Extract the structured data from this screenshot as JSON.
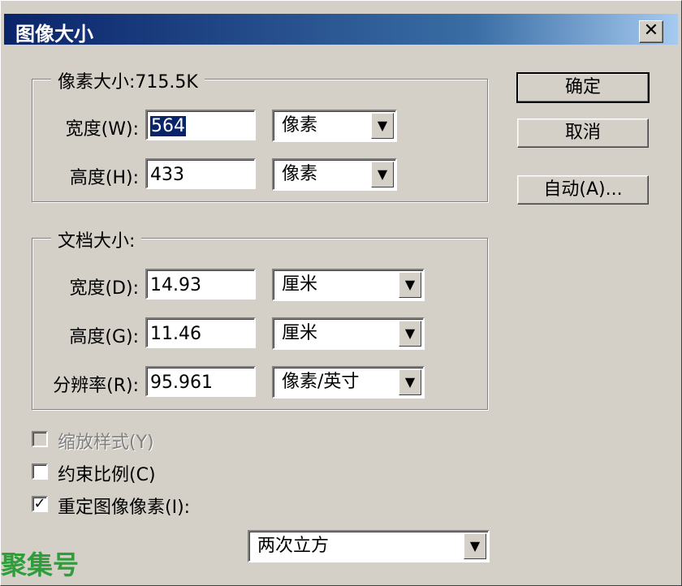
{
  "window": {
    "title": "图像大小",
    "close_glyph": "✕"
  },
  "pixel_dimensions": {
    "legend": "像素大小:715.5K",
    "width": {
      "label": "宽度(W):",
      "value": "564",
      "unit": "像素"
    },
    "height": {
      "label": "高度(H):",
      "value": "433",
      "unit": "像素"
    }
  },
  "document_size": {
    "legend": "文档大小:",
    "width": {
      "label": "宽度(D):",
      "value": "14.93",
      "unit": "厘米"
    },
    "height": {
      "label": "高度(G):",
      "value": "11.46",
      "unit": "厘米"
    },
    "resolution": {
      "label": "分辨率(R):",
      "value": "95.961",
      "unit": "像素/英寸"
    }
  },
  "buttons": {
    "ok": "确定",
    "cancel": "取消",
    "auto": "自动(A)..."
  },
  "options": {
    "scale_styles": {
      "label": "缩放样式(Y)",
      "checked": false,
      "enabled": false
    },
    "constrain": {
      "label": "约束比例(C)",
      "checked": false
    },
    "resample": {
      "label": "重定图像像素(I):",
      "checked": true,
      "check_glyph": "✓"
    }
  },
  "resample_method": "两次立方",
  "watermark": "聚集号",
  "icons": {
    "dropdown": "▼"
  }
}
